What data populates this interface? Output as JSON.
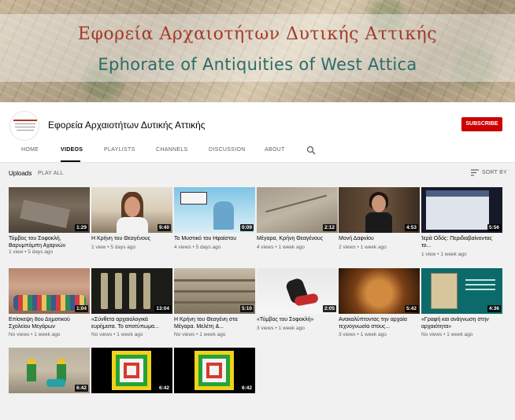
{
  "banner": {
    "title_greek": "Εφορεία Αρχαιοτήτων Δυτικής Αττικής",
    "title_english": "Ephorate of Antiquities of West Attica"
  },
  "channel": {
    "name": "Εφορεία Αρχαιοτήτων Δυτικής Αττικής",
    "subscribe_label": "SUBSCRIBE"
  },
  "tabs": [
    {
      "label": "HOME"
    },
    {
      "label": "VIDEOS"
    },
    {
      "label": "PLAYLISTS"
    },
    {
      "label": "CHANNELS"
    },
    {
      "label": "DISCUSSION"
    },
    {
      "label": "ABOUT"
    }
  ],
  "active_tab": "VIDEOS",
  "section": {
    "title": "Uploads",
    "play_all": "PLAY ALL",
    "sort_by": "SORT BY"
  },
  "colors": {
    "subscribe": "#cc0000",
    "page_bg": "#f1f1f1"
  },
  "videos": [
    {
      "title": "Τύμβος του Σοφοκλή, Βαρυμπόμπη Αχαρνών",
      "duration": "1:29",
      "views": "1 view",
      "age": "5 days ago"
    },
    {
      "title": "Η Κρήνη του Θεαγένους",
      "duration": "9:40",
      "views": "1 view",
      "age": "5 days ago"
    },
    {
      "title": "Το Μυστικό του Ηφαίστου",
      "duration": "0:09",
      "views": "4 views",
      "age": "5 days ago"
    },
    {
      "title": "Μέγαρα, Κρήνη Θεαγένους",
      "duration": "2:12",
      "views": "4 views",
      "age": "1 week ago"
    },
    {
      "title": "Μονή Δαφνίου",
      "duration": "4:53",
      "views": "2 views",
      "age": "1 week ago"
    },
    {
      "title": "Ίερά Οδός: Περιδιαβαίνοντας το...",
      "duration": "5:56",
      "views": "1 view",
      "age": "1 week ago"
    },
    {
      "title": "Επίσκεψη 8ου Δημοτικού Σχολείου Μεγάρων",
      "duration": "1:04",
      "views": "No views",
      "age": "1 week ago"
    },
    {
      "title": "«Σύνθετα αρχαιολογικά ευρήματα. Το αποτύπωμα...",
      "duration": "13:04",
      "views": "No views",
      "age": "1 week ago"
    },
    {
      "title": "Η Κρήνη του Θεαγένη στα Μέγαρα. Μελέτη &...",
      "duration": "5:10",
      "views": "No views",
      "age": "1 week ago"
    },
    {
      "title": "«Τύμβος του Σοφοκλή»",
      "duration": "2:05",
      "views": "3 views",
      "age": "1 week ago"
    },
    {
      "title": "Ανακαλύπτοντας την αρχαία τεχνογνωσία στους...",
      "duration": "5:42",
      "views": "3 views",
      "age": "1 week ago"
    },
    {
      "title": "«Γραφή και ανάγνωση στην αρχαιότητα»",
      "duration": "4:36",
      "views": "No views",
      "age": "1 week ago"
    },
    {
      "title": "",
      "duration": "6:42",
      "views": "",
      "age": ""
    },
    {
      "title": "",
      "duration": "6:42",
      "views": "",
      "age": ""
    },
    {
      "title": "",
      "duration": "6:42",
      "views": "",
      "age": ""
    }
  ]
}
